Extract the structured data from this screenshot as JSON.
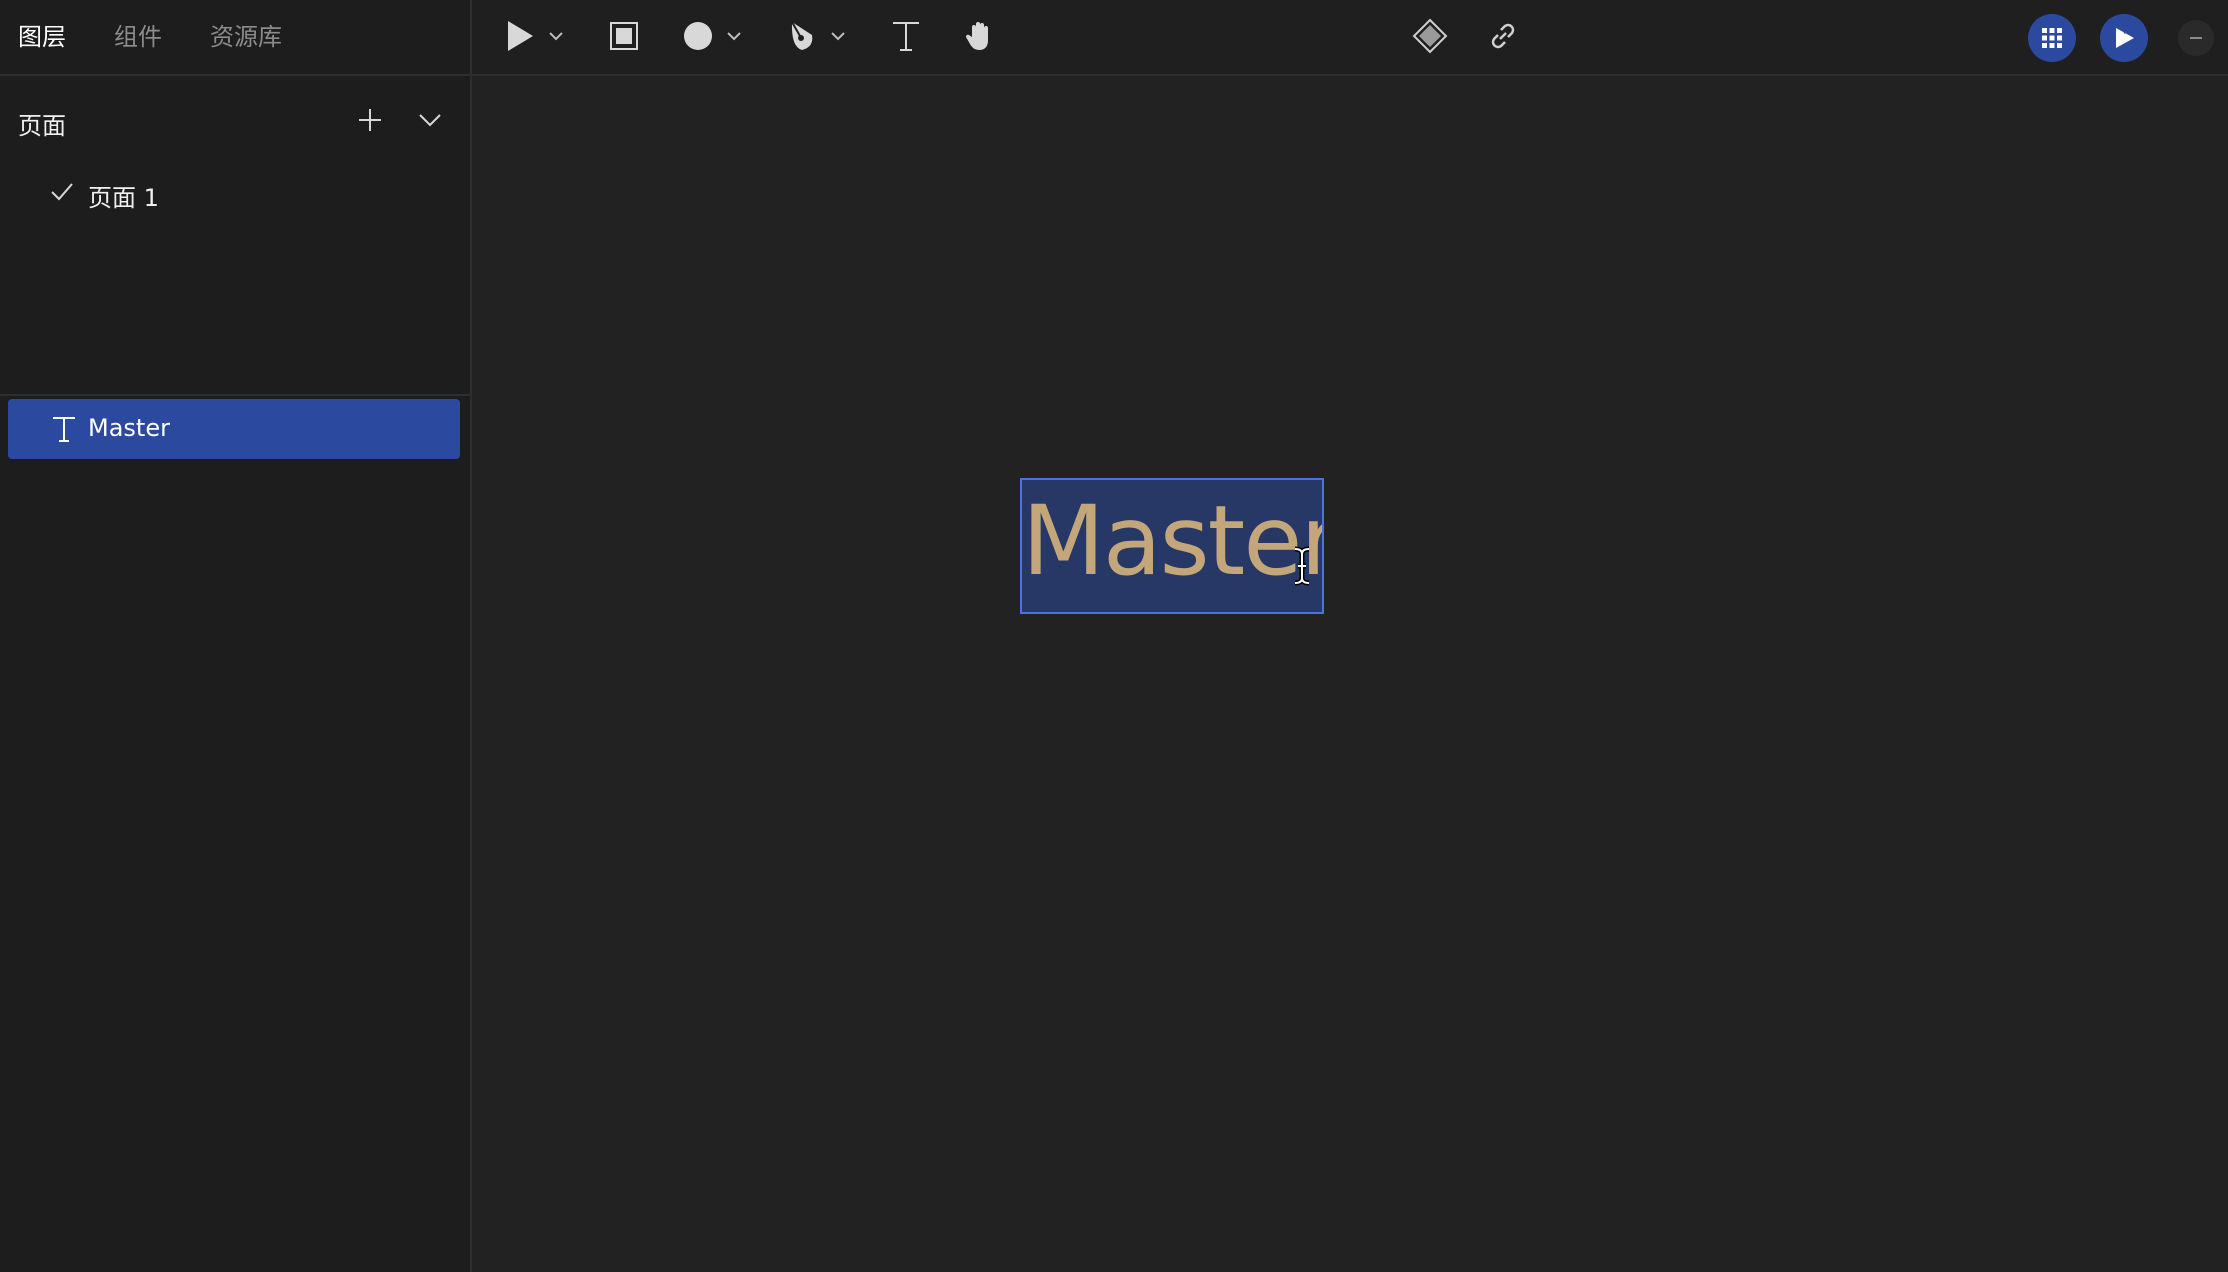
{
  "sidebar": {
    "tabs": [
      {
        "label": "图层",
        "active": true
      },
      {
        "label": "组件",
        "active": false
      },
      {
        "label": "资源库",
        "active": false
      }
    ],
    "pages_title": "页面",
    "pages": [
      {
        "label": "页面 1",
        "selected": true
      }
    ],
    "layers": [
      {
        "label": "Master",
        "type": "text",
        "selected": true
      }
    ]
  },
  "toolbar": {
    "tools": [
      {
        "name": "select-tool",
        "icon": "pointer-icon"
      },
      {
        "name": "frame-tool",
        "icon": "frame-icon"
      },
      {
        "name": "shape-tool",
        "icon": "ellipse-icon"
      },
      {
        "name": "pen-tool",
        "icon": "pen-icon"
      },
      {
        "name": "text-tool",
        "icon": "text-icon"
      },
      {
        "name": "hand-tool",
        "icon": "hand-icon"
      },
      {
        "name": "component-tool",
        "icon": "diamond-icon"
      },
      {
        "name": "link-tool",
        "icon": "link-icon"
      }
    ],
    "right_buttons": [
      {
        "name": "grid-menu-button",
        "icon": "grid-icon"
      },
      {
        "name": "preview-button",
        "icon": "play-icon"
      },
      {
        "name": "more-button",
        "icon": "minus-icon"
      }
    ]
  },
  "canvas": {
    "text_content": "Master"
  },
  "colors": {
    "selection": "#2b4a9f",
    "selection_border": "#4a72e0",
    "canvas_text": "#c3a77a",
    "background": "#1c1c1c"
  }
}
